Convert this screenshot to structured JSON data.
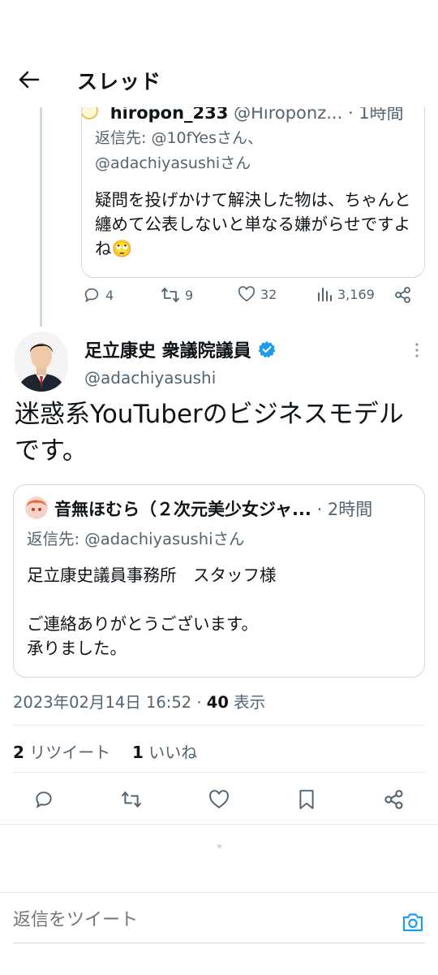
{
  "header": {
    "title": "スレッド"
  },
  "quoted_reply": {
    "author_name": "hiropon_233",
    "author_handle": "@Hiroponz...",
    "time": "· 1時間",
    "reply_to_label": "返信先:",
    "reply_to_1": "@10fYesさん、",
    "reply_to_2": "@adachiyasushiさん",
    "text": "疑問を投げかけて解決した物は、ちゃんと纏めて公表しないと単なる嫌がらせですよね🙄"
  },
  "reply_actions": {
    "replies": "4",
    "retweets": "9",
    "likes": "32",
    "views": "3,169"
  },
  "main_tweet": {
    "author_name": "足立康史 衆議院議員",
    "author_handle": "@adachiyasushi",
    "text": "迷惑系YouTuberのビジネスモデルです。",
    "timestamp": "2023年02月14日 16:52 · ",
    "views_count": "40",
    "views_label": " 表示",
    "retweet_count": "2",
    "retweet_label": " リツイート",
    "like_count": "1",
    "like_label": " いいね"
  },
  "quoted_tweet": {
    "author_name": "音無ほむら（２次元美少女ジャ...",
    "time": " · 2時間",
    "reply_to": "返信先: @adachiyasushiさん",
    "text": "足立康史議員事務所　スタッフ様\n\nご連絡ありがとうございます。\n承りました。"
  },
  "reply_bar": {
    "placeholder": "返信をツイート"
  },
  "colors": {
    "accent": "#1d9bf0",
    "muted": "#536471",
    "border": "#cfd9de",
    "text": "#0f1419"
  },
  "icons": [
    "back-arrow-icon",
    "reply-icon",
    "retweet-icon",
    "like-icon",
    "views-icon",
    "share-icon",
    "verified-badge-icon",
    "more-icon",
    "bookmark-icon",
    "camera-icon"
  ]
}
